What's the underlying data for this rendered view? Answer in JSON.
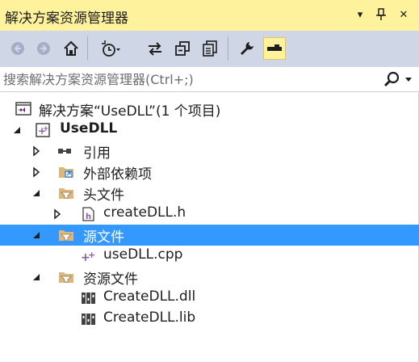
{
  "window": {
    "title": "解决方案资源管理器",
    "title_buttons": {
      "dropdown": "▾",
      "pin": "pin-icon",
      "close": "✕"
    }
  },
  "toolbar": {
    "buttons": [
      "back-icon",
      "forward-icon",
      "home-icon",
      "history-icon",
      "sync-icon",
      "collapse-all-icon",
      "show-all-files-icon",
      "properties-icon",
      "preview-icon"
    ],
    "active": "preview-icon"
  },
  "search": {
    "placeholder": "搜索解决方案资源管理器(Ctrl+;)"
  },
  "tree": {
    "solution": "解决方案“UseDLL”(1 个项目)",
    "project": "UseDLL",
    "references": "引用",
    "external_deps": "外部依赖项",
    "headers_folder": "头文件",
    "header_file": "createDLL.h",
    "source_folder": "源文件",
    "source_file": "useDLL.cpp",
    "resource_folder": "资源文件",
    "resource_files": [
      "CreateDLL.dll",
      "CreateDLL.lib"
    ]
  },
  "colors": {
    "title_bg": "#fff29d",
    "toolbar_bg": "#cfd6e5",
    "selection_bg": "#3399ff",
    "folder": "#dcb67a",
    "cpp_purple": "#8a5ea8"
  }
}
